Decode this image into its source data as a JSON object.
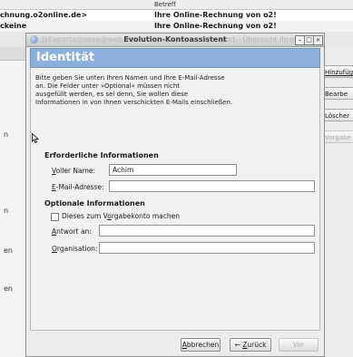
{
  "background": {
    "column_header": "Betreff",
    "rows": [
      {
        "sender": "chnung.o2online.de>",
        "subject": "Ihre Online-Rechnung von o2!"
      },
      {
        "sender": "ckeine",
        "subject": "Ihre Online-Rechnung von o2!"
      }
    ],
    "left_fragments": [
      "n",
      "n",
      "en",
      "en"
    ],
    "right_buttons": [
      {
        "label": "Hinzufüg",
        "disabled": false
      },
      {
        "label": "Bearbe",
        "disabled": false
      },
      {
        "label": "Löscher",
        "disabled": false
      },
      {
        "label": "Vorgabe",
        "disabled": true
      }
    ]
  },
  "dialog": {
    "title": "Evolution-Kontoassistent",
    "title_ghost": "@Exportadresse@web.de",
    "title_ghost_right": "port - Übersicht Ihrer",
    "buttons": {
      "minimize": "–",
      "maximize": "□",
      "close": "×"
    },
    "heading": "Identität",
    "intro_lines": [
      "Bitte geben Sie unten Ihren Namen und Ihre E-Mail-Adresse",
      "an. Die Felder unter »Optional« müssen nicht",
      "ausgefüllt werden, es sei denn, Sie wollen diese",
      "Informationen in von Ihnen verschickten E-Mails einschließen."
    ],
    "required_section": "Erforderliche Informationen",
    "full_name_label_key": "V",
    "full_name_label_rest": "oller Name:",
    "full_name_value": "Achim",
    "email_label_key": "E",
    "email_label_rest": "-Mail-Adresse:",
    "email_value": "",
    "optional_section": "Optionale Informationen",
    "default_account_label_pre": "Dieses zum V",
    "default_account_label_key": "o",
    "default_account_label_post": "rgabekonto machen",
    "default_account_checked": false,
    "reply_to_label_key": "A",
    "reply_to_label_rest": "ntwort an:",
    "reply_to_value": "",
    "org_label_key": "O",
    "org_label_rest": "rganisation:",
    "org_value": "",
    "cancel_key": "A",
    "cancel_rest": "bbrechen",
    "back_key": "Z",
    "back_rest": "urück",
    "next_label": "Vor"
  },
  "colors": {
    "banner": "#8bb0dc",
    "banner_text": "#ffffff"
  }
}
